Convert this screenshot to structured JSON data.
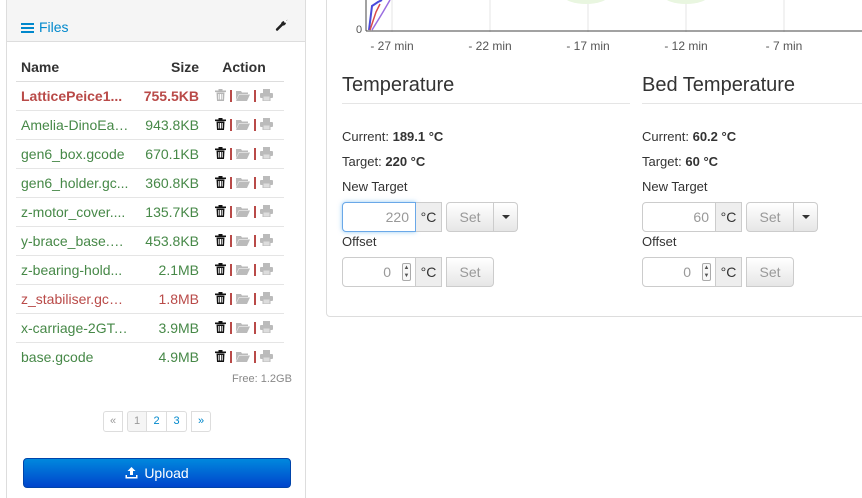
{
  "files": {
    "title": "Files",
    "columns": {
      "name": "Name",
      "size": "Size",
      "action": "Action"
    },
    "rows": [
      {
        "name": "LatticePeice1...",
        "size": "755.5KB",
        "status": "active"
      },
      {
        "name": "Amelia-DinoEar...",
        "size": "943.8KB",
        "status": "ok"
      },
      {
        "name": "gen6_box.gcode",
        "size": "670.1KB",
        "status": "ok"
      },
      {
        "name": "gen6_holder.gc...",
        "size": "360.8KB",
        "status": "ok"
      },
      {
        "name": "z-motor_cover....",
        "size": "135.7KB",
        "status": "ok"
      },
      {
        "name": "y-brace_base.g...",
        "size": "453.8KB",
        "status": "ok"
      },
      {
        "name": "z-bearing-hold...",
        "size": "2.1MB",
        "status": "ok"
      },
      {
        "name": "z_stabiliser.gcode",
        "size": "1.8MB",
        "status": "failed"
      },
      {
        "name": "x-carriage-2GT....",
        "size": "3.9MB",
        "status": "ok"
      },
      {
        "name": "base.gcode",
        "size": "4.9MB",
        "status": "ok"
      }
    ],
    "free_space": "Free: 1.2GB",
    "pagination": {
      "prev": "«",
      "pages": [
        "1",
        "2",
        "3"
      ],
      "current": "1",
      "next": "»"
    },
    "upload_label": "Upload",
    "colors": {
      "ok": "#468847",
      "failed": "#b94a48",
      "accent": "#0088cc"
    }
  },
  "graph": {
    "y_zero_label": "0",
    "x_ticks": [
      "- 27 min",
      "- 22 min",
      "- 17 min",
      "- 12 min",
      "- 7 min"
    ]
  },
  "temperature": {
    "title": "Temperature",
    "current_label": "Current:",
    "current_value": "189.1 °C",
    "target_label": "Target:",
    "target_value": "220 °C",
    "new_target_label": "New Target",
    "new_target_value": "220",
    "unit": "°C",
    "set_label": "Set",
    "offset_label": "Offset",
    "offset_value": "0"
  },
  "bed": {
    "title": "Bed Temperature",
    "current_label": "Current:",
    "current_value": "60.2 °C",
    "target_label": "Target:",
    "target_value": "60 °C",
    "new_target_label": "New Target",
    "new_target_value": "60",
    "unit": "°C",
    "set_label": "Set",
    "offset_label": "Offset",
    "offset_value": "0"
  }
}
